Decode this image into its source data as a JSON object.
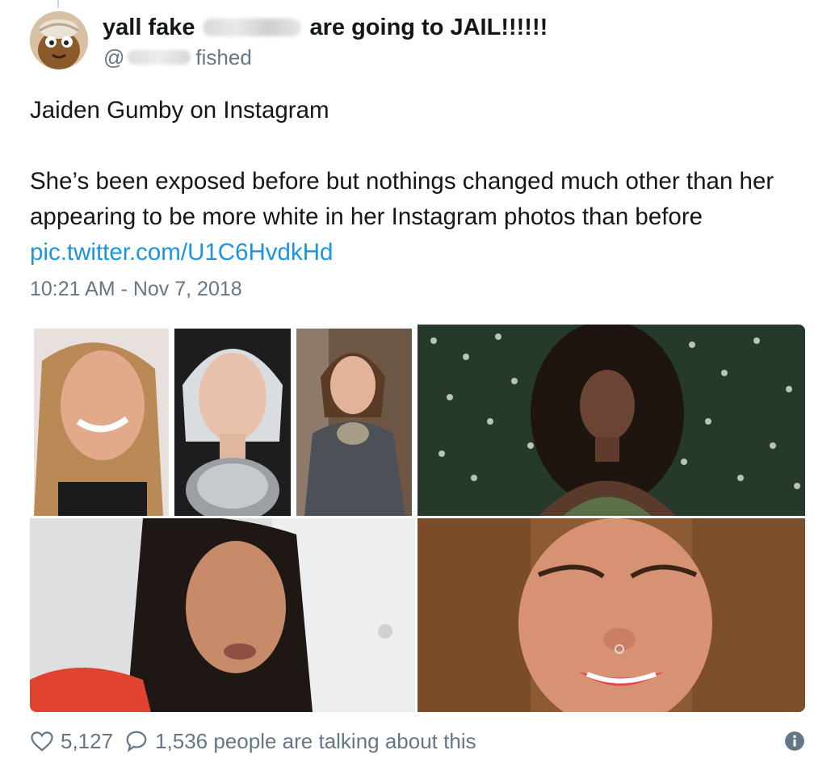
{
  "user": {
    "name_prefix": "yall fake",
    "name_suffix": "are going to JAIL!!!!!!",
    "handle_prefix": "@",
    "handle_suffix": "fished"
  },
  "tweet": {
    "line1": "Jaiden Gumby on Instagram",
    "line2": "She’s been exposed before but nothings changed much other than her appearing to be more white in her Instagram photos than before",
    "link": "pic.twitter.com/U1C6HvdkHd",
    "timestamp": "10:21 AM - Nov 7, 2018"
  },
  "footer": {
    "likes": "5,127",
    "talking": "1,536 people are talking about this"
  },
  "colors": {
    "link": "#1b95e0",
    "muted": "#657786",
    "text": "#14171a"
  },
  "icons": [
    "heart-icon",
    "speech-bubble-icon",
    "info-icon"
  ]
}
